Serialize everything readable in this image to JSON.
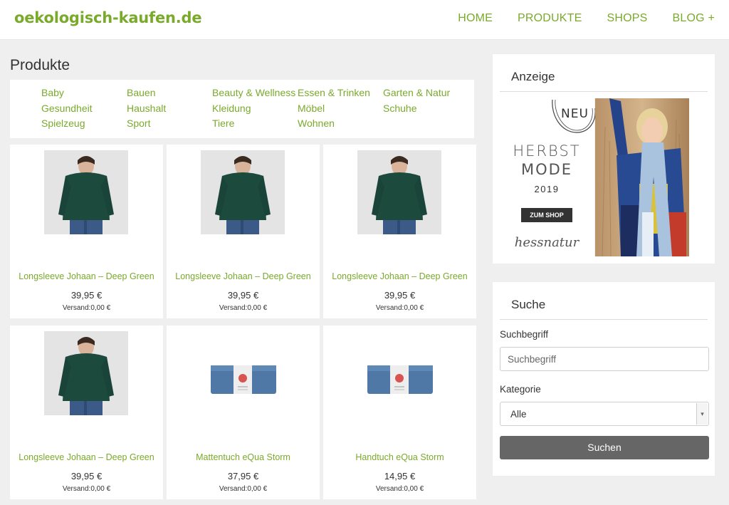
{
  "header": {
    "logo": "oekologisch-kaufen.de",
    "nav": [
      "HOME",
      "PRODUKTE",
      "SHOPS",
      "BLOG +"
    ]
  },
  "main": {
    "title": "Produkte",
    "categories": [
      "Baby",
      "Bauen",
      "Beauty & Wellness",
      "Essen & Trinken",
      "Garten & Natur",
      "Gesundheit",
      "Haushalt",
      "Kleidung",
      "Möbel",
      "Schuhe",
      "Spielzeug",
      "Sport",
      "Tiere",
      "Wohnen"
    ],
    "products": [
      {
        "name": "Longsleeve Johaan – Deep Green",
        "price": "39,95 €",
        "shipping": "Versand:0,00 €",
        "image": "sweater"
      },
      {
        "name": "Longsleeve Johaan – Deep Green",
        "price": "39,95 €",
        "shipping": "Versand:0,00 €",
        "image": "sweater"
      },
      {
        "name": "Longsleeve Johaan – Deep Green",
        "price": "39,95 €",
        "shipping": "Versand:0,00 €",
        "image": "sweater"
      },
      {
        "name": "Longsleeve Johaan – Deep Green",
        "price": "39,95 €",
        "shipping": "Versand:0,00 €",
        "image": "sweater"
      },
      {
        "name": "Mattentuch eQua Storm",
        "price": "37,95 €",
        "shipping": "Versand:0,00 €",
        "image": "towel"
      },
      {
        "name": "Handtuch eQua Storm",
        "price": "14,95 €",
        "shipping": "Versand:0,00 €",
        "image": "towel"
      }
    ]
  },
  "sidebar": {
    "ad": {
      "title": "Anzeige",
      "badge": "NEU",
      "line1": "HERBST",
      "line2": "MODE",
      "year": "2019",
      "button": "ZUM SHOP",
      "brand": "hessnatur"
    },
    "search": {
      "title": "Suche",
      "term_label": "Suchbegriff",
      "term_placeholder": "Suchbegriff",
      "category_label": "Kategorie",
      "category_value": "Alle",
      "button": "Suchen"
    }
  },
  "colors": {
    "accent": "#7aaa2b",
    "button": "#666666",
    "background": "#efefef"
  }
}
